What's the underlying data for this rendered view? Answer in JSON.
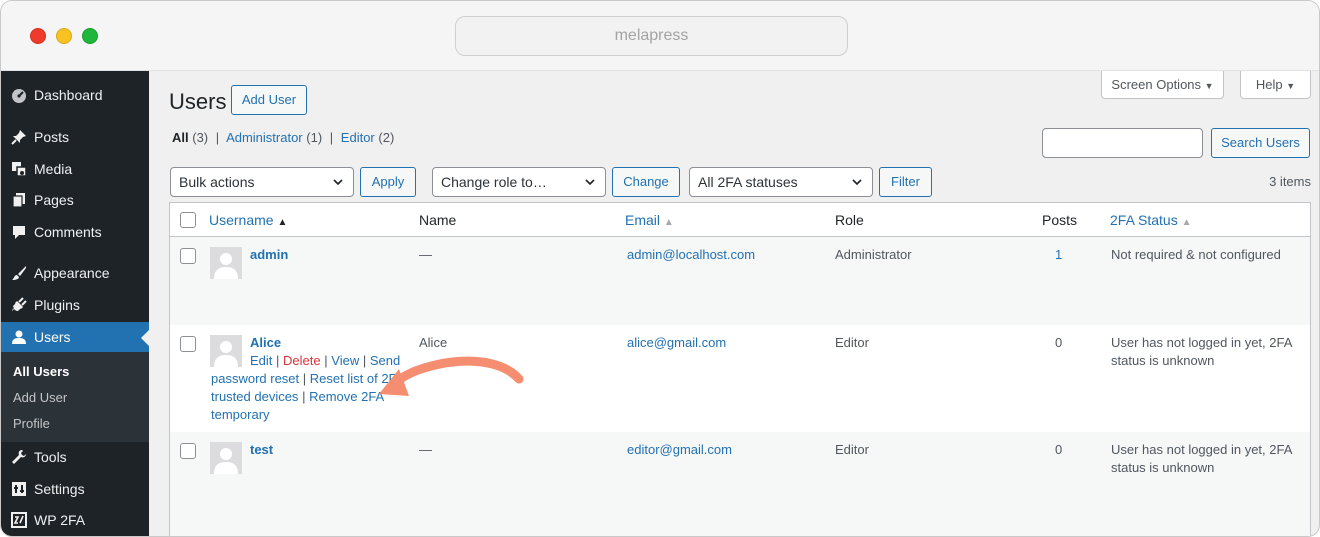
{
  "browser": {
    "url": "melapress"
  },
  "sidebar": {
    "items": [
      {
        "label": "Dashboard",
        "icon": "dashboard-icon"
      },
      {
        "label": "Posts",
        "icon": "pin-icon"
      },
      {
        "label": "Media",
        "icon": "media-icon"
      },
      {
        "label": "Pages",
        "icon": "pages-icon"
      },
      {
        "label": "Comments",
        "icon": "comment-icon"
      },
      {
        "label": "Appearance",
        "icon": "brush-icon"
      },
      {
        "label": "Plugins",
        "icon": "plug-icon"
      },
      {
        "label": "Users",
        "icon": "user-icon"
      },
      {
        "label": "Tools",
        "icon": "wrench-icon"
      },
      {
        "label": "Settings",
        "icon": "settings-icon"
      },
      {
        "label": "WP 2FA",
        "icon": "wp2fa-icon"
      }
    ],
    "submenu": [
      "All Users",
      "Add User",
      "Profile"
    ]
  },
  "header": {
    "title": "Users",
    "add_user": "Add User",
    "screen_options": "Screen Options",
    "help": "Help"
  },
  "views": {
    "all": "All",
    "all_count": "(3)",
    "admin": "Administrator",
    "admin_count": "(1)",
    "editor": "Editor",
    "editor_count": "(2)",
    "divider": "|"
  },
  "search": {
    "button": "Search Users",
    "value": ""
  },
  "filters": {
    "bulk": "Bulk actions",
    "apply": "Apply",
    "role": "Change role to…",
    "change": "Change",
    "status": "All 2FA statuses",
    "filter": "Filter",
    "count": "3 items"
  },
  "table": {
    "columns": [
      "Username",
      "Name",
      "Email",
      "Role",
      "Posts",
      "2FA Status"
    ],
    "rows": [
      {
        "username": "admin",
        "name": "—",
        "email": "admin@localhost.com",
        "role": "Administrator",
        "posts": "1",
        "status": "Not required & not configured"
      },
      {
        "username": "Alice",
        "name": "Alice",
        "email": "alice@gmail.com",
        "role": "Editor",
        "posts": "0",
        "status_1": "User has not logged in yet, 2FA",
        "status_2": "status is unknown"
      },
      {
        "username": "test",
        "name": "—",
        "email": "editor@gmail.com",
        "role": "Editor",
        "posts": "0",
        "status_1": "User has not logged in yet, 2FA",
        "status_2": "status is unknown"
      }
    ],
    "row_actions": {
      "edit": "Edit",
      "delete": "Delete",
      "view": "View",
      "send": "Send",
      "password_reset": "password reset",
      "reset_list": "Reset list of 2FA",
      "trusted_devices": "trusted devices",
      "remove_2fa": "Remove 2FA",
      "temporary": "temporary",
      "divider": "|"
    }
  },
  "colors": {
    "accent": "#2271b1",
    "sidebar": "#1d2327",
    "arrow": "#f58e70"
  }
}
